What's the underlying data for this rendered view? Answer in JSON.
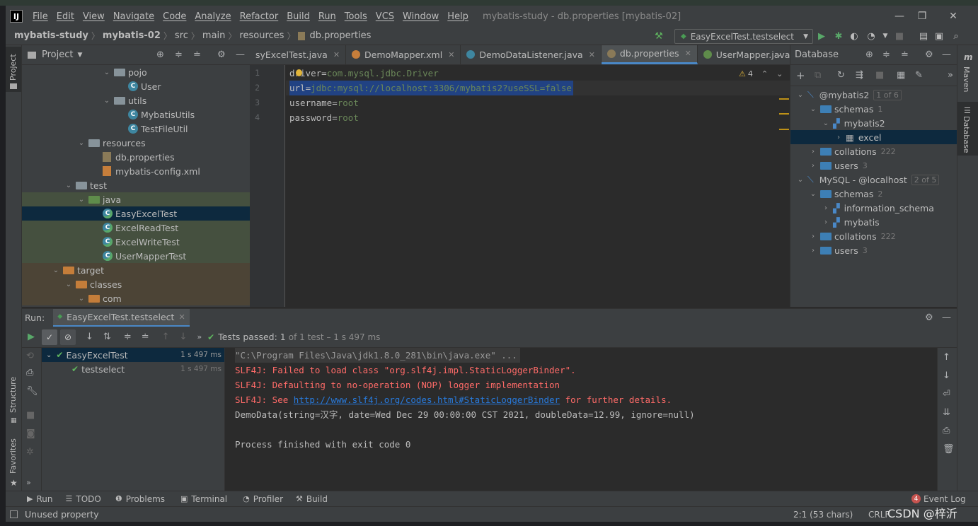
{
  "app": {
    "logo": "IJ",
    "window_title": "mybatis-study - db.properties [mybatis-02]"
  },
  "menu": [
    "File",
    "Edit",
    "View",
    "Navigate",
    "Code",
    "Analyze",
    "Refactor",
    "Build",
    "Run",
    "Tools",
    "VCS",
    "Window",
    "Help"
  ],
  "window_controls": {
    "minimize": "—",
    "maximize": "❐",
    "close": "✕"
  },
  "breadcrumb": [
    "mybatis-study",
    "mybatis-02",
    "src",
    "main",
    "resources",
    "db.properties"
  ],
  "run_config": "EasyExcelTest.testselect",
  "left_strip": {
    "project": "Project",
    "structure": "Structure",
    "favorites": "Favorites"
  },
  "project_panel": {
    "title": "Project",
    "tree": [
      {
        "label": "pojo",
        "type": "folder",
        "expanded": true,
        "state": ""
      },
      {
        "label": "User",
        "type": "class",
        "state": ""
      },
      {
        "label": "utils",
        "type": "folder",
        "expanded": true,
        "state": ""
      },
      {
        "label": "MybatisUtils",
        "type": "class",
        "state": ""
      },
      {
        "label": "TestFileUtil",
        "type": "class",
        "state": ""
      },
      {
        "label": "resources",
        "type": "folder",
        "expanded": true,
        "state": ""
      },
      {
        "label": "db.properties",
        "type": "props",
        "state": ""
      },
      {
        "label": "mybatis-config.xml",
        "type": "xml",
        "state": ""
      },
      {
        "label": "test",
        "type": "folder",
        "expanded": true,
        "state": ""
      },
      {
        "label": "java",
        "type": "folder-green",
        "expanded": true,
        "state": "grn"
      },
      {
        "label": "EasyExcelTest",
        "type": "test",
        "state": "sel"
      },
      {
        "label": "ExcelReadTest",
        "type": "test",
        "state": "grn"
      },
      {
        "label": "ExcelWriteTest",
        "type": "test",
        "state": "grn"
      },
      {
        "label": "UserMapperTest",
        "type": "test",
        "state": "grn"
      },
      {
        "label": "target",
        "type": "folder-orange",
        "expanded": true,
        "state": "brn"
      },
      {
        "label": "classes",
        "type": "folder-orange",
        "expanded": true,
        "state": "brn"
      },
      {
        "label": "com",
        "type": "folder-orange",
        "expanded": true,
        "state": "brn"
      }
    ]
  },
  "editor": {
    "tabs": [
      {
        "label": "syExcelTest.java",
        "active": false,
        "color": "#3e86a0"
      },
      {
        "label": "DemoMapper.xml",
        "active": false,
        "color": "#c67e3b"
      },
      {
        "label": "DemoDataListener.java",
        "active": false,
        "color": "#3e86a0"
      },
      {
        "label": "db.properties",
        "active": true,
        "color": "#8a7a58"
      },
      {
        "label": "UserMapper.java",
        "active": false,
        "color": "#5f8c4b"
      }
    ],
    "line_numbers": [
      "1",
      "2",
      "3",
      "4"
    ],
    "lines": [
      {
        "key": "driver",
        "value": "com.mysql.jdbc.Driver"
      },
      {
        "key": "url",
        "value": "jdbc:mysql://localhost:3306/mybatis2?useSSL=false"
      },
      {
        "key": "username",
        "value": "root"
      },
      {
        "key": "password",
        "value": "root"
      }
    ],
    "warnings": "4"
  },
  "database_panel": {
    "title": "Database",
    "tree": [
      {
        "label": "@mybatis2",
        "count": "1 of 6",
        "boxed": true
      },
      {
        "label": "schemas",
        "count": "1"
      },
      {
        "label": "mybatis2",
        "count": ""
      },
      {
        "label": "excel",
        "count": ""
      },
      {
        "label": "collations",
        "count": "222"
      },
      {
        "label": "users",
        "count": "3"
      },
      {
        "label": "MySQL - @localhost",
        "count": "2 of 5",
        "boxed": true
      },
      {
        "label": "schemas",
        "count": "2"
      },
      {
        "label": "information_schema",
        "count": ""
      },
      {
        "label": "mybatis",
        "count": ""
      },
      {
        "label": "collations",
        "count": "222"
      },
      {
        "label": "users",
        "count": "3"
      }
    ]
  },
  "right_strip": {
    "maven": "Maven",
    "database": "Database"
  },
  "run_panel": {
    "label": "Run:",
    "tab": "EasyExcelTest.testselect",
    "status_prefix": "Tests passed:",
    "status_count": "1",
    "status_suffix": "of 1 test – 1 s 497 ms",
    "tree": [
      {
        "label": "EasyExcelTest",
        "time": "1 s 497 ms"
      },
      {
        "label": "testselect",
        "time": "1 s 497 ms"
      }
    ],
    "console": [
      {
        "text": "\"C:\\Program Files\\Java\\jdk1.8.0_281\\bin\\java.exe\" ..."
      },
      {
        "text": "SLF4J: Failed to load class \"org.slf4j.impl.StaticLoggerBinder\"."
      },
      {
        "text": "SLF4J: Defaulting to no-operation (NOP) logger implementation"
      },
      {
        "prefix": "SLF4J: See ",
        "link": "http://www.slf4j.org/codes.html#StaticLoggerBinder",
        "suffix": " for further details."
      },
      {
        "text": "DemoData(string=汉字, date=Wed Dec 29 00:00:00 CST 2021, doubleData=12.99, ignore=null)"
      },
      {
        "text": ""
      },
      {
        "text": "Process finished with exit code 0"
      }
    ]
  },
  "bottom_tools": [
    "Run",
    "TODO",
    "Problems",
    "Terminal",
    "Profiler",
    "Build"
  ],
  "event_log": {
    "count": "4",
    "label": "Event Log"
  },
  "status": {
    "message": "Unused property",
    "position": "2:1 (53 chars)",
    "line_sep": "CRLF",
    "watermark": "CSDN @梓沂"
  }
}
